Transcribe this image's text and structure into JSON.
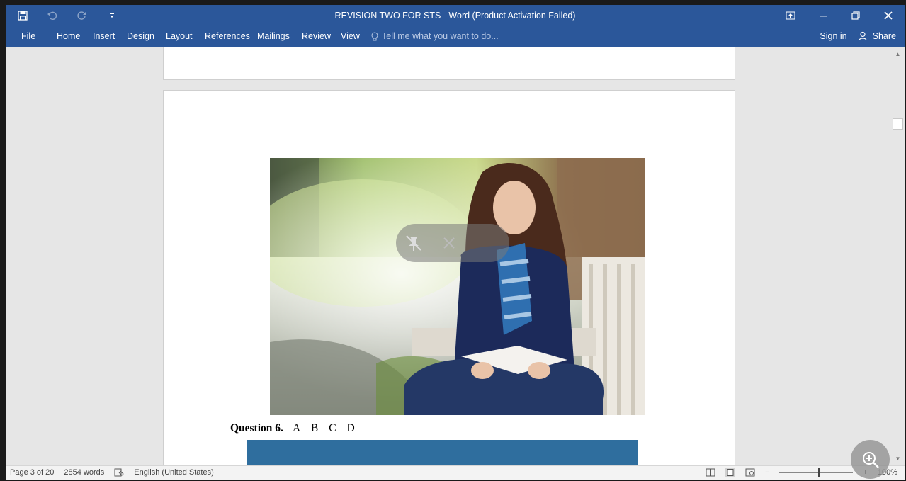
{
  "titlebar": {
    "title": "REVISION TWO FOR STS - Word (Product Activation Failed)",
    "qat": [
      "save-icon",
      "undo-icon",
      "redo-icon",
      "customize-qat-icon"
    ]
  },
  "tabs": {
    "file": "File",
    "home": "Home",
    "insert": "Insert",
    "design": "Design",
    "layout": "Layout",
    "references": "References",
    "mailings": "Mailings",
    "review": "Review",
    "view": "View",
    "tell_me": "Tell me what you want to do...",
    "sign_in": "Sign in",
    "share": "Share"
  },
  "document": {
    "question_label": "Question 6.",
    "options": [
      "A",
      "B",
      "C",
      "D"
    ]
  },
  "status": {
    "page": "Page 3 of 20",
    "words": "2854 words",
    "language": "English (United States)",
    "zoom": "100%",
    "zoom_level": 1.0
  },
  "colors": {
    "ribbon": "#2b579a",
    "canvas": "#e6e6e6",
    "blue_box": "#2f6e9e"
  }
}
